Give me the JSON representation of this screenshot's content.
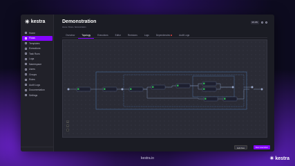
{
  "app": {
    "name": "kestra"
  },
  "sidebar": {
    "items": [
      {
        "label": "Home"
      },
      {
        "label": "Flows",
        "active": true
      },
      {
        "label": "Templates"
      },
      {
        "label": "Executions"
      },
      {
        "label": "Task Runs"
      },
      {
        "label": "Logs"
      },
      {
        "label": "Namespace"
      },
      {
        "label": "Users"
      },
      {
        "label": "Groups"
      },
      {
        "label": "Roles"
      },
      {
        "label": "Audit Logs"
      },
      {
        "label": "Documentation"
      },
      {
        "label": "Settings"
      }
    ]
  },
  "header": {
    "title": "Demonstration",
    "breadcrumb": "Home / Flows / demonstration",
    "pill": "EN-WE"
  },
  "tabs": [
    {
      "label": "Overview"
    },
    {
      "label": "Topology",
      "active": true
    },
    {
      "label": "Executions"
    },
    {
      "label": "Editor"
    },
    {
      "label": "Revisions"
    },
    {
      "label": "Logs"
    },
    {
      "label": "Dependencies",
      "alert": true
    },
    {
      "label": "Audit Logs"
    }
  ],
  "canvas": {
    "zoom_in": "+",
    "zoom_out": "−"
  },
  "actions": {
    "edit": "Edit flow",
    "new_execution": "New execution"
  },
  "footer": {
    "url": "kestra.io",
    "corner_logo": "kestra"
  },
  "colors": {
    "accent": "#8405ff",
    "background": "#0d0b1f",
    "window": "#1b1c24"
  }
}
